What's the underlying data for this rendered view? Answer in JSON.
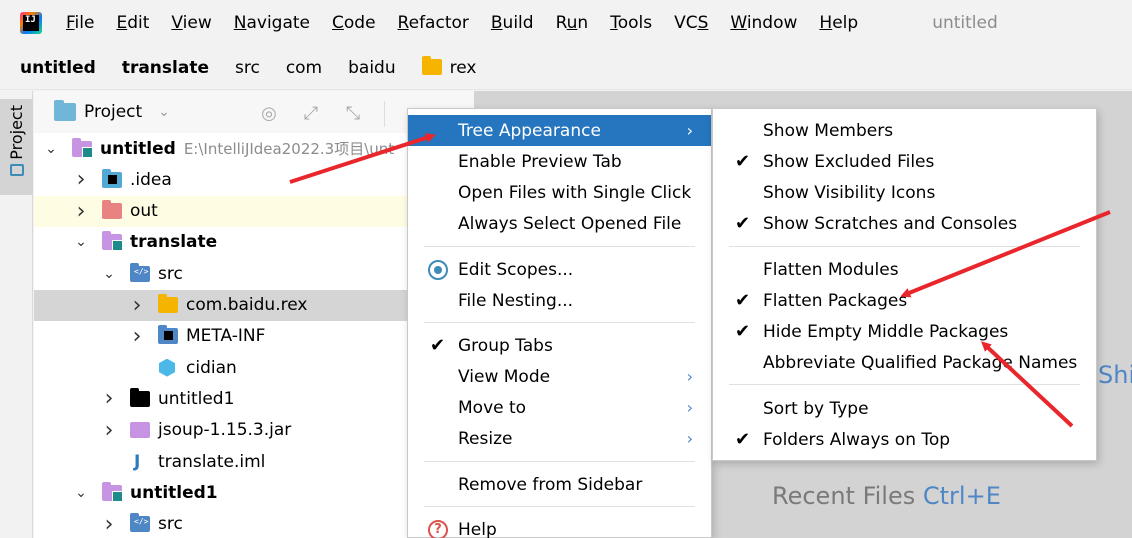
{
  "menubar": {
    "logo": "IJ",
    "items": [
      {
        "label": "File",
        "mnemonic_index": 0
      },
      {
        "label": "Edit",
        "mnemonic_index": 0
      },
      {
        "label": "View",
        "mnemonic_index": 0
      },
      {
        "label": "Navigate",
        "mnemonic_index": 0
      },
      {
        "label": "Code",
        "mnemonic_index": 0
      },
      {
        "label": "Refactor",
        "mnemonic_index": 0
      },
      {
        "label": "Build",
        "mnemonic_index": 0
      },
      {
        "label": "Run",
        "mnemonic_index": 1
      },
      {
        "label": "Tools",
        "mnemonic_index": 0
      },
      {
        "label": "VCS",
        "mnemonic_index": 2
      },
      {
        "label": "Window",
        "mnemonic_index": 0
      },
      {
        "label": "Help",
        "mnemonic_index": 0
      }
    ],
    "window_title": "untitled"
  },
  "breadcrumb": [
    "untitled",
    "translate",
    "src",
    "com",
    "baidu",
    "rex"
  ],
  "toolstrip": {
    "project_tab": "Project"
  },
  "panel": {
    "title": "Project",
    "tree": [
      {
        "label": "untitled",
        "bold": true,
        "path": "E:\\IntelliJIdea2022.3项目\\unt",
        "icon": "module",
        "chevron": "down"
      },
      {
        "label": ".idea",
        "icon": "idea",
        "chevron": "right"
      },
      {
        "label": "out",
        "icon": "out",
        "chevron": "right"
      },
      {
        "label": "translate",
        "bold": true,
        "icon": "module",
        "chevron": "down"
      },
      {
        "label": "src",
        "icon": "src",
        "chevron": "down"
      },
      {
        "label": "com.baidu.rex",
        "icon": "pkg",
        "chevron": "right"
      },
      {
        "label": "META-INF",
        "icon": "meta",
        "chevron": "right"
      },
      {
        "label": "cidian",
        "icon": "cidian",
        "chevron": ""
      },
      {
        "label": "untitled1",
        "icon": "black",
        "chevron": "right"
      },
      {
        "label": "jsoup-1.15.3.jar",
        "icon": "jar",
        "chevron": "right"
      },
      {
        "label": "translate.iml",
        "icon": "iml",
        "chevron": ""
      },
      {
        "label": "untitled1",
        "bold": true,
        "icon": "module",
        "chevron": "down"
      },
      {
        "label": "src",
        "icon": "src",
        "chevron": "right"
      }
    ]
  },
  "main_menu": {
    "items": [
      {
        "label": "Tree Appearance",
        "submenu": true,
        "selected": true
      },
      {
        "label": "Enable Preview Tab"
      },
      {
        "label": "Open Files with Single Click"
      },
      {
        "label": "Always Select Opened File"
      },
      {
        "label": "Edit Scopes...",
        "icon": "scope"
      },
      {
        "label": "File Nesting..."
      },
      {
        "label": "Group Tabs",
        "checked": true
      },
      {
        "label": "View Mode",
        "submenu": true
      },
      {
        "label": "Move to",
        "submenu": true
      },
      {
        "label": "Resize",
        "submenu": true
      },
      {
        "label": "Remove from Sidebar"
      },
      {
        "label": "Help",
        "icon": "help"
      }
    ]
  },
  "sub_menu": {
    "items": [
      {
        "label": "Show Members",
        "checked": false
      },
      {
        "label": "Show Excluded Files",
        "checked": true
      },
      {
        "label": "Show Visibility Icons",
        "checked": false
      },
      {
        "label": "Show Scratches and Consoles",
        "checked": true
      },
      {
        "label": "Flatten Modules",
        "checked": false
      },
      {
        "label": "Flatten Packages",
        "checked": true
      },
      {
        "label": "Hide Empty Middle Packages",
        "checked": true
      },
      {
        "label": "Abbreviate Qualified Package Names",
        "checked": false
      },
      {
        "label": "Sort by Type",
        "checked": false
      },
      {
        "label": "Folders Always on Top",
        "checked": true
      }
    ]
  },
  "editor": {
    "partial_text": "Shi",
    "recent_files": "Recent Files",
    "recent_files_shortcut": "Ctrl+E"
  },
  "colors": {
    "selection": "#2675bf",
    "annotation_arrow": "#e8262b"
  }
}
